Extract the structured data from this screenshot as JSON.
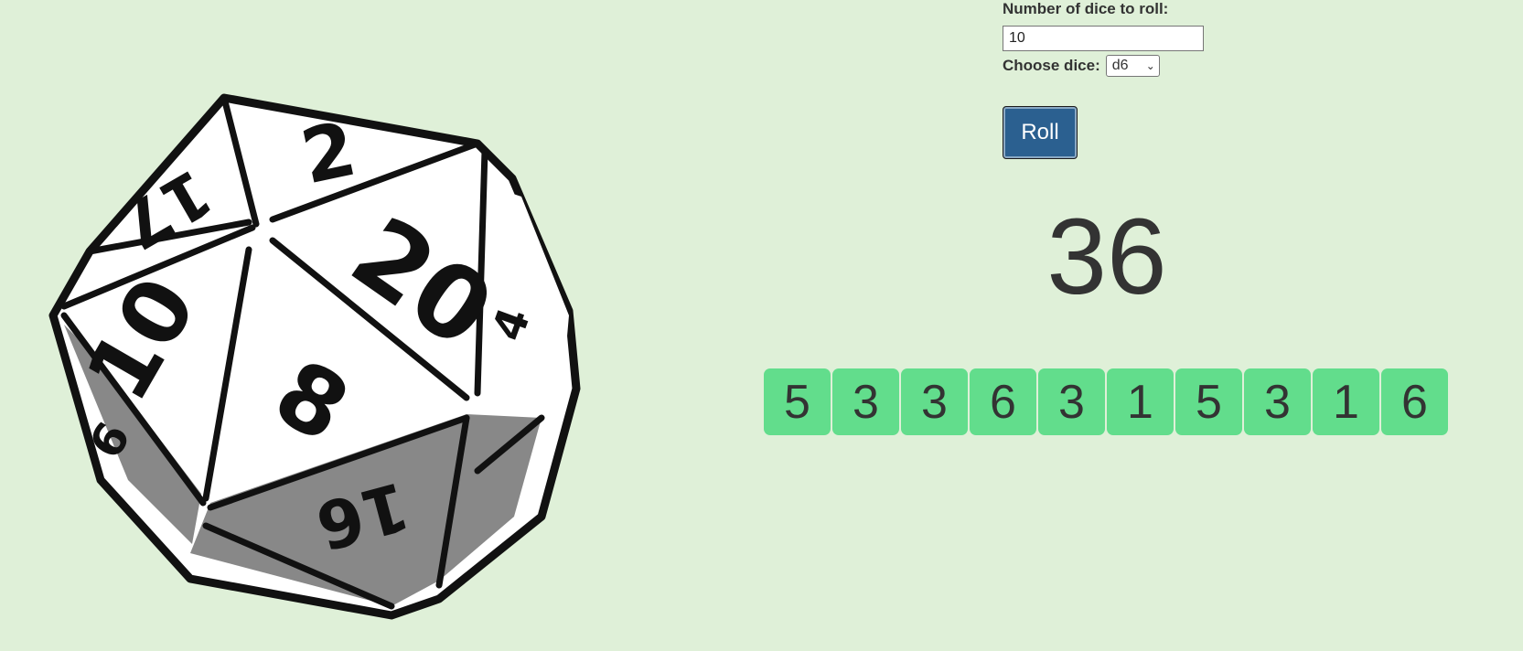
{
  "form": {
    "count_label": "Number of dice to roll:",
    "count_value": "10",
    "choose_label": "Choose dice:",
    "dice_selected": "d6",
    "roll_label": "Roll"
  },
  "total": "36",
  "results": [
    "5",
    "3",
    "3",
    "6",
    "3",
    "1",
    "5",
    "3",
    "1",
    "6"
  ],
  "d20": {
    "numbers": [
      "2",
      "20",
      "17",
      "10",
      "8",
      "4",
      "16",
      "6"
    ]
  },
  "colors": {
    "background": "#dff0d8",
    "die_tile": "#62dd8c",
    "roll_button": "#2b6090"
  }
}
